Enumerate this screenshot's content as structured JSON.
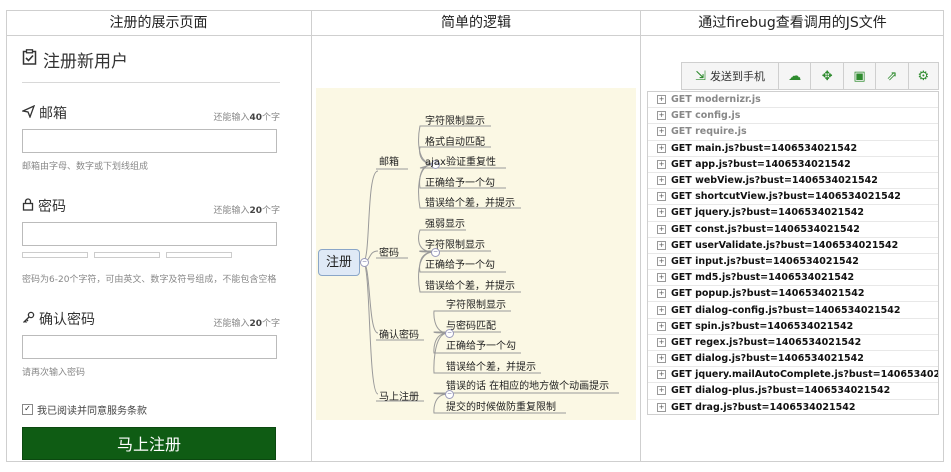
{
  "headers": {
    "left": "注册的展示页面",
    "middle": "简单的逻辑",
    "right": "通过firebug查看调用的JS文件"
  },
  "form": {
    "title": "注册新用户",
    "remain_prefix": "还能输入",
    "remain_suffix": "个字",
    "email": {
      "label": "邮箱",
      "count": "40",
      "value": "",
      "help": "邮箱由字母、数字或下划线组成"
    },
    "password": {
      "label": "密码",
      "count": "20",
      "value": "",
      "help": "密码为6-20个字符，可由英文、数字及符号组成，不能包含空格"
    },
    "confirm": {
      "label": "确认密码",
      "count": "20",
      "value": "",
      "help": "请再次输入密码"
    },
    "agree_label": "我已阅读并同意服务条款",
    "submit_label": "马上注册"
  },
  "mindmap": {
    "root": "注册",
    "branches": [
      {
        "name": "邮箱",
        "children": [
          "字符限制显示",
          "格式自动匹配",
          "ajax验证重复性",
          "正确给予一个勾",
          "错误给个差，并提示"
        ]
      },
      {
        "name": "密码",
        "children": [
          "强弱显示",
          "字符限制显示",
          "正确给予一个勾",
          "错误给个差，并提示"
        ]
      },
      {
        "name": "确认密码",
        "children": [
          "字符限制显示",
          "与密码匹配",
          "正确给予一个勾",
          "错误给个差，并提示"
        ]
      },
      {
        "name": "马上注册",
        "children": [
          "错误的话 在相应的地方做个动画提示",
          "提交的时候做防重复限制"
        ]
      }
    ]
  },
  "firebug": {
    "send_label": "发送到手机",
    "toolbar_icons": [
      "send-to-phone-icon",
      "cloud-icon",
      "expand-icon",
      "save-icon",
      "share-icon",
      "gear-icon"
    ],
    "requests": [
      {
        "text": "GET modernizr.js",
        "muted": true
      },
      {
        "text": "GET config.js",
        "muted": true
      },
      {
        "text": "GET require.js",
        "muted": true
      },
      {
        "text": "GET main.js?bust=1406534021542",
        "muted": false
      },
      {
        "text": "GET app.js?bust=1406534021542",
        "muted": false
      },
      {
        "text": "GET webView.js?bust=1406534021542",
        "muted": false
      },
      {
        "text": "GET shortcutView.js?bust=1406534021542",
        "muted": false
      },
      {
        "text": "GET jquery.js?bust=1406534021542",
        "muted": false
      },
      {
        "text": "GET const.js?bust=1406534021542",
        "muted": false
      },
      {
        "text": "GET userValidate.js?bust=1406534021542",
        "muted": false
      },
      {
        "text": "GET input.js?bust=1406534021542",
        "muted": false
      },
      {
        "text": "GET md5.js?bust=1406534021542",
        "muted": false
      },
      {
        "text": "GET popup.js?bust=1406534021542",
        "muted": false
      },
      {
        "text": "GET dialog-config.js?bust=1406534021542",
        "muted": false
      },
      {
        "text": "GET spin.js?bust=1406534021542",
        "muted": false
      },
      {
        "text": "GET regex.js?bust=1406534021542",
        "muted": false
      },
      {
        "text": "GET dialog.js?bust=1406534021542",
        "muted": false
      },
      {
        "text": "GET jquery.mailAutoComplete.js?bust=1406534021542",
        "muted": false
      },
      {
        "text": "GET dialog-plus.js?bust=1406534021542",
        "muted": false
      },
      {
        "text": "GET drag.js?bust=1406534021542",
        "muted": false
      }
    ]
  }
}
